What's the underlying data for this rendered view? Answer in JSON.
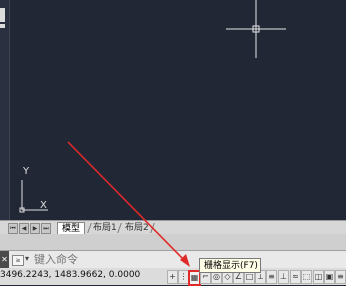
{
  "tabs": {
    "model": "模型",
    "layout1": "布局1",
    "layout2": "布局2"
  },
  "ucs": {
    "y_label": "Y",
    "x_label": "X"
  },
  "command": {
    "placeholder": "键入命令"
  },
  "status": {
    "coordinates": "3496.2243, 1483.9662, 0.0000"
  },
  "tooltip": {
    "text": "栅格显示(F7)"
  },
  "colors": {
    "canvas": "#212735",
    "annotation": "#e02a2a"
  }
}
